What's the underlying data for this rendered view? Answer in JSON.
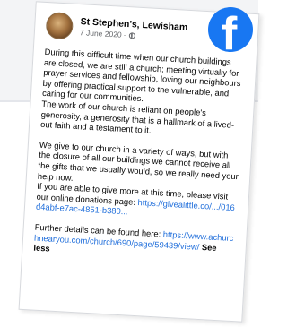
{
  "post": {
    "page_name": "St Stephen's, Lewisham",
    "date": "7 June 2020",
    "date_separator": "·",
    "body": {
      "p1": "During this difficult time when our church buildings are closed, we are still a church; meeting virtually for prayer services and fellowship, loving our neighbours by offering practical support to the vulnerable, and caring for our communities.",
      "p2": "The work of our church is reliant on people's generosity, a generosity that is a hallmark of a lived-out faith and a testament to it.",
      "p3": "We give to our church in a variety of ways, but with the closure of all our buildings we cannot receive all the gifts that we usually would, so we really need your help now.",
      "p4": "If you are able to give more at this time, please visit our online donations page:",
      "p4_link": "https://givealittle.co/.../016d4abf-e7ac-4851-b380...",
      "p5": "Further details can be found here:",
      "p5_link": "https://www.achurchnearyou.com/church/690/page/59439/view/",
      "see_less": "See less"
    }
  },
  "badge": {
    "icon": "facebook-logo-icon",
    "glyph": "f",
    "color": "#1877f2"
  }
}
